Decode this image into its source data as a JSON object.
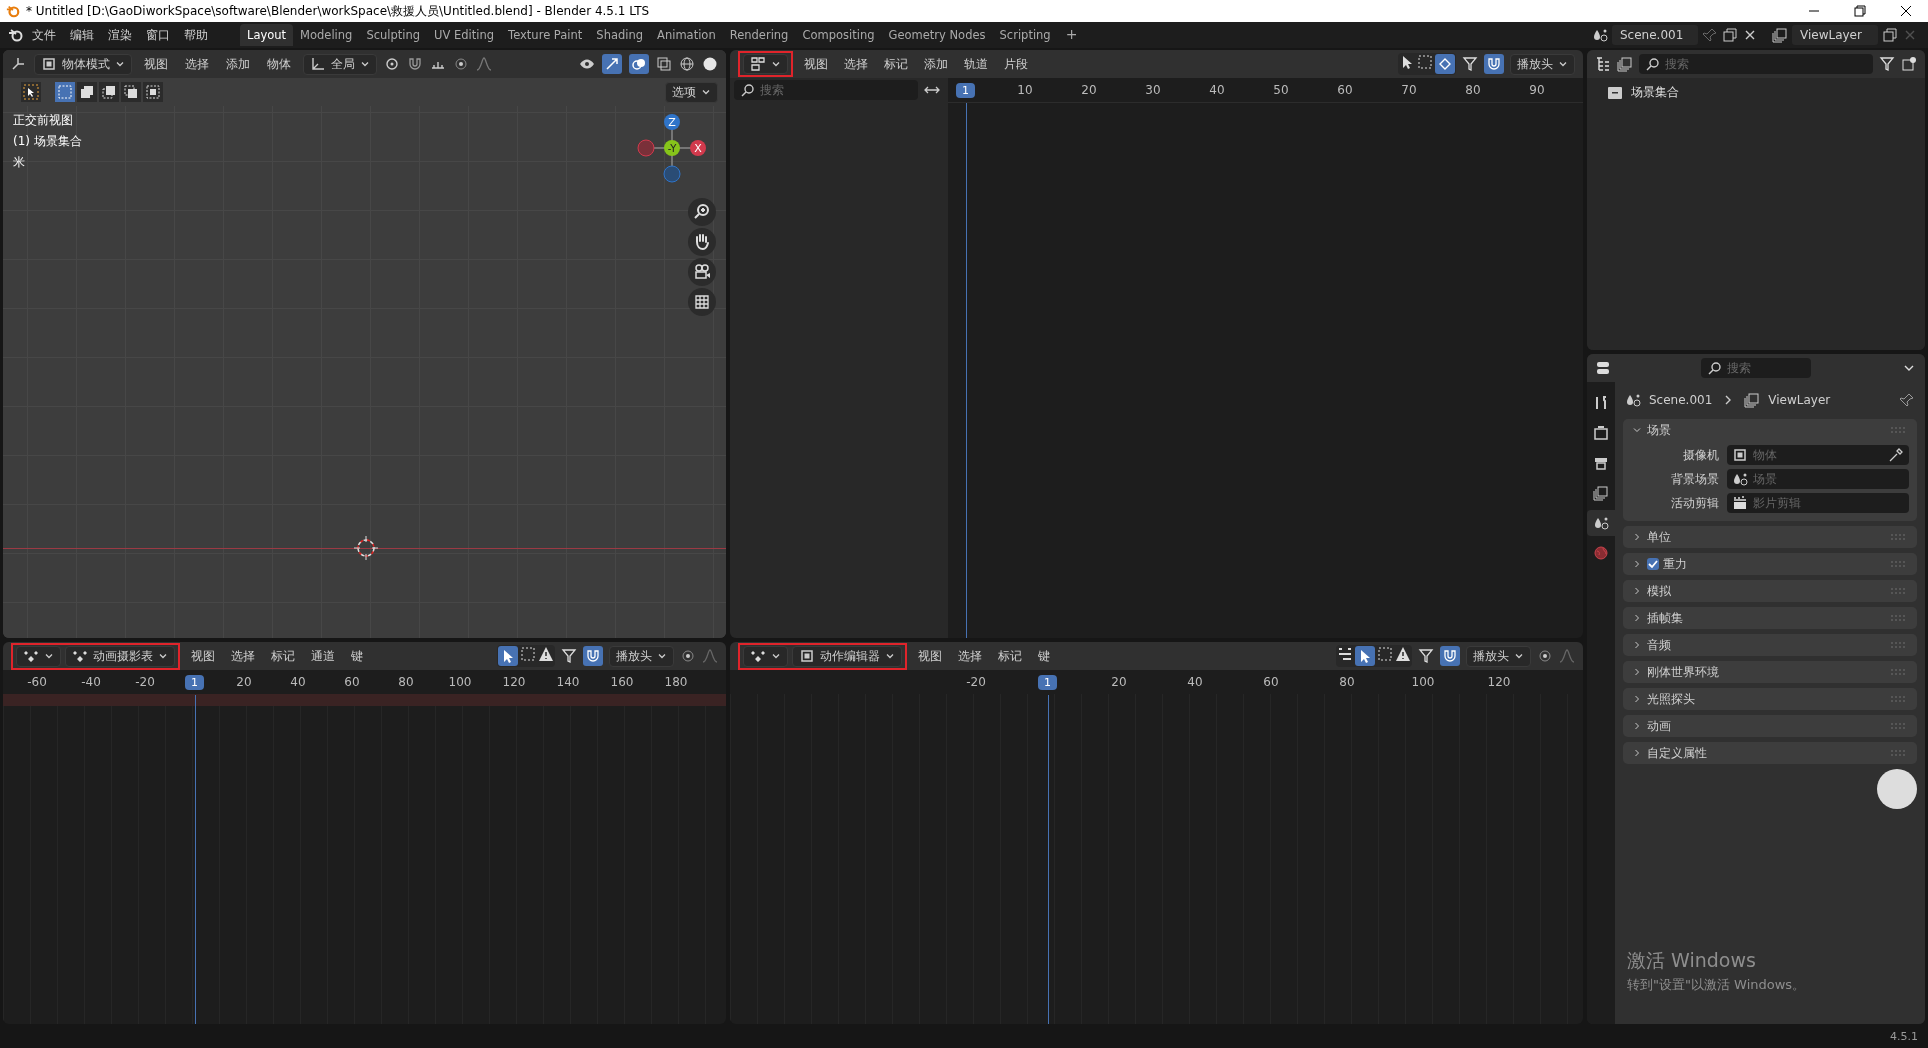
{
  "title_bar": {
    "title": "* Untitled [D:\\GaoDiworkSpace\\software\\Blender\\workSpace\\救援人员\\Untitled.blend] - Blender 4.5.1 LTS"
  },
  "menu": [
    "文件",
    "编辑",
    "渲染",
    "窗口",
    "帮助"
  ],
  "workspaces": [
    {
      "label": "Layout",
      "selected": true
    },
    {
      "label": "Modeling",
      "selected": false
    },
    {
      "label": "Sculpting",
      "selected": false
    },
    {
      "label": "UV Editing",
      "selected": false
    },
    {
      "label": "Texture Paint",
      "selected": false
    },
    {
      "label": "Shading",
      "selected": false
    },
    {
      "label": "Animation",
      "selected": false
    },
    {
      "label": "Rendering",
      "selected": false
    },
    {
      "label": "Compositing",
      "selected": false
    },
    {
      "label": "Geometry Nodes",
      "selected": false
    },
    {
      "label": "Scripting",
      "selected": false
    }
  ],
  "add_workspace": "+",
  "scene_selector": {
    "scene": "Scene.001",
    "view_layer": "ViewLayer"
  },
  "viewport": {
    "mode": "物体模式",
    "menus": [
      "视图",
      "选择",
      "添加",
      "物体"
    ],
    "orientation": "全局",
    "options": "选项",
    "overlay_lines": [
      "正交前视图",
      "(1) 场景集合",
      "米"
    ],
    "gizmo_axes": [
      "Z",
      "-Y",
      "X"
    ]
  },
  "nla": {
    "highlighted": true,
    "menus": [
      "视图",
      "选择",
      "标记",
      "添加",
      "轨道",
      "片段"
    ],
    "playhead": "播放头",
    "search_placeholder": "搜索",
    "ruler": [
      {
        "kind": "current",
        "label": "1"
      },
      {
        "kind": "tick",
        "label": "10"
      },
      {
        "kind": "tick",
        "label": "20"
      },
      {
        "kind": "tick",
        "label": "30"
      },
      {
        "kind": "tick",
        "label": "40"
      },
      {
        "kind": "tick",
        "label": "50"
      },
      {
        "kind": "tick",
        "label": "60"
      },
      {
        "kind": "tick",
        "label": "70"
      },
      {
        "kind": "tick",
        "label": "80"
      },
      {
        "kind": "tick",
        "label": "90"
      }
    ]
  },
  "outliner": {
    "search_placeholder": "搜索",
    "items": [
      "场景集合"
    ]
  },
  "dopesheet": {
    "highlighted": true,
    "mode": "动画摄影表",
    "menus": [
      "视图",
      "选择",
      "标记",
      "通道",
      "键"
    ],
    "playhead": "播放头",
    "ruler": [
      {
        "kind": "tick",
        "label": "-60"
      },
      {
        "kind": "tick",
        "label": "-40"
      },
      {
        "kind": "tick",
        "label": "-20"
      },
      {
        "kind": "current",
        "label": "1"
      },
      {
        "kind": "tick",
        "label": "20"
      },
      {
        "kind": "tick",
        "label": "40"
      },
      {
        "kind": "tick",
        "label": "60"
      },
      {
        "kind": "tick",
        "label": "80"
      },
      {
        "kind": "tick",
        "label": "100"
      },
      {
        "kind": "tick",
        "label": "120"
      },
      {
        "kind": "tick",
        "label": "140"
      },
      {
        "kind": "tick",
        "label": "160"
      },
      {
        "kind": "tick",
        "label": "180"
      }
    ]
  },
  "action_editor": {
    "highlighted": true,
    "mode": "动作编辑器",
    "menus": [
      "视图",
      "选择",
      "标记",
      "键"
    ],
    "playhead": "播放头",
    "ruler": [
      {
        "kind": "tick",
        "label": "-20"
      },
      {
        "kind": "current",
        "label": "1"
      },
      {
        "kind": "tick",
        "label": "20"
      },
      {
        "kind": "tick",
        "label": "40"
      },
      {
        "kind": "tick",
        "label": "60"
      },
      {
        "kind": "tick",
        "label": "80"
      },
      {
        "kind": "tick",
        "label": "100"
      },
      {
        "kind": "tick",
        "label": "120"
      }
    ]
  },
  "properties": {
    "search_placeholder": "搜索",
    "breadcrumb": [
      "Scene.001",
      "ViewLayer"
    ],
    "tabs": [
      {
        "kind": "tool",
        "selected": false
      },
      {
        "kind": "render",
        "selected": false
      },
      {
        "kind": "output",
        "selected": false
      },
      {
        "kind": "view_layer",
        "selected": false
      },
      {
        "kind": "scene",
        "selected": true
      },
      {
        "kind": "world",
        "selected": false
      }
    ],
    "panels": [
      {
        "title": "场景",
        "expanded": true,
        "fields": [
          {
            "label": "摄像机",
            "placeholder": "物体",
            "kind": "object"
          },
          {
            "label": "背景场景",
            "placeholder": "场景",
            "kind": "scene"
          },
          {
            "label": "活动剪辑",
            "placeholder": "影片剪辑",
            "kind": "clip"
          }
        ]
      },
      {
        "title": "单位",
        "expanded": false
      },
      {
        "title": "重力",
        "expanded": false,
        "checked": true
      },
      {
        "title": "模拟",
        "expanded": false
      },
      {
        "title": "插帧集",
        "expanded": false
      },
      {
        "title": "音频",
        "expanded": false
      },
      {
        "title": "刚体世界环境",
        "expanded": false
      },
      {
        "title": "光照探头",
        "expanded": false
      },
      {
        "title": "动画",
        "expanded": false
      },
      {
        "title": "自定义属性",
        "expanded": false
      }
    ]
  },
  "activation_notice": {
    "title": "激活 Windows",
    "text": "转到\"设置\"以激活 Windows。"
  },
  "status_bar": {
    "version": "4.5.1"
  }
}
